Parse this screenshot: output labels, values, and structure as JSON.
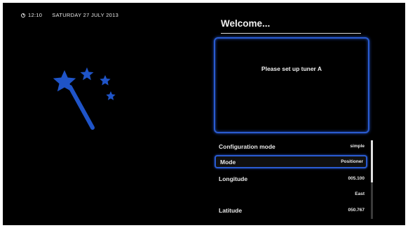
{
  "header": {
    "time": "12:10",
    "date": "SATURDAY 27 JULY 2013",
    "clock_icon": "clock-icon"
  },
  "wizard": {
    "icon": "magic-wand-icon",
    "accent_color": "#1f54c8"
  },
  "title": "Welcome...",
  "info": {
    "message": "Please set up tuner A"
  },
  "config": {
    "rows": [
      {
        "label": "Configuration mode",
        "value": "simple"
      },
      {
        "label": "Mode",
        "value": "Positioner",
        "selected": true
      },
      {
        "label": "Longitude",
        "value": "005.100"
      },
      {
        "label": "",
        "value": "East"
      },
      {
        "label": "Latitude",
        "value": "050.767"
      }
    ]
  },
  "colors": {
    "background": "#000000",
    "highlight_border": "#2a5bd0",
    "text": "#e8e8e8"
  }
}
